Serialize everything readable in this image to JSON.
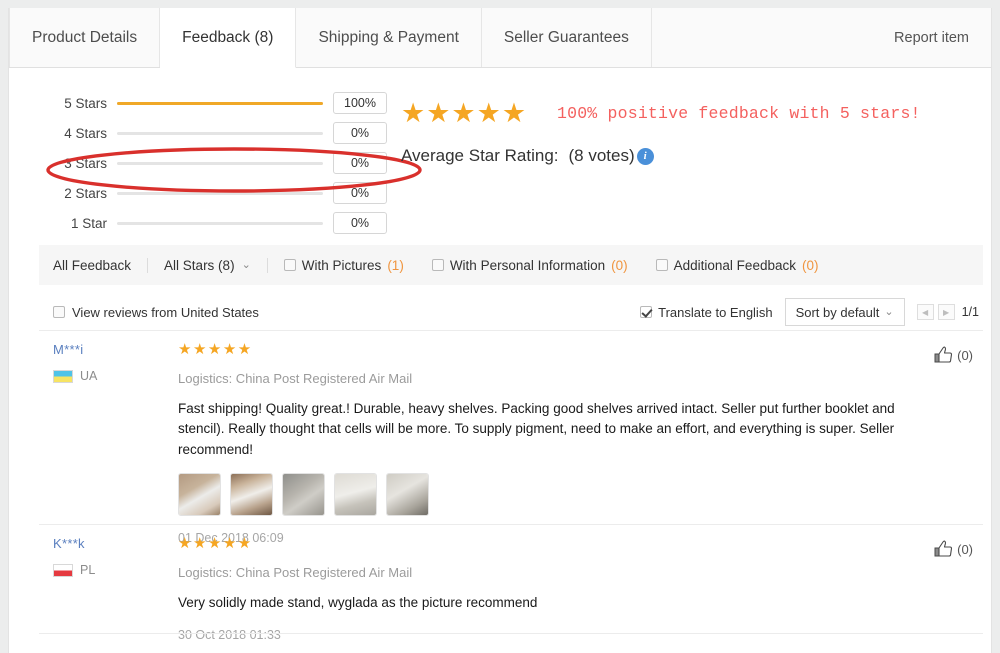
{
  "tabs": [
    {
      "label": "Product Details",
      "active": false
    },
    {
      "label": "Feedback (8)",
      "active": true
    },
    {
      "label": "Shipping & Payment",
      "active": false
    },
    {
      "label": "Seller Guarantees",
      "active": false
    }
  ],
  "report_item": "Report item",
  "rating": {
    "bars": [
      {
        "label": "5 Stars",
        "percent_label": "100%",
        "percent": 100
      },
      {
        "label": "4 Stars",
        "percent_label": "0%",
        "percent": 0
      },
      {
        "label": "3 Stars",
        "percent_label": "0%",
        "percent": 0
      },
      {
        "label": "2 Stars",
        "percent_label": "0%",
        "percent": 0
      },
      {
        "label": "1 Star",
        "percent_label": "0%",
        "percent": 0
      }
    ],
    "stars_display": "★★★★★",
    "average_label": "Average Star Rating:",
    "votes": "(8 votes)",
    "info_glyph": "i",
    "annotation_text": "100% positive feedback with 5 stars!",
    "annotation_color": "#f4615f",
    "bar_fill_color": "#f0a828",
    "star_color": "#f5a623"
  },
  "filters": {
    "all_feedback": "All Feedback",
    "all_stars": "All Stars (8)",
    "chevron": "⌄",
    "with_pictures_label": "With Pictures ",
    "with_pictures_count": "(1)",
    "with_personal_label": "With Personal Information",
    "with_personal_count": "(0)",
    "additional_label": "Additional Feedback ",
    "additional_count": "(0)"
  },
  "subfilters": {
    "view_reviews_country": "View reviews from United States",
    "translate_label": "Translate to English",
    "sort_label": "Sort by default",
    "sort_chevron": "⌄",
    "prev_glyph": "◀",
    "next_glyph": "▶",
    "page_count": "1/1"
  },
  "reviews": [
    {
      "user": "M***i",
      "country_code": "UA",
      "flag_class": "flag-ua",
      "stars": "★★★★★",
      "logistics": "Logistics: China Post Registered Air Mail",
      "text": "Fast shipping! Quality great.! Durable, heavy shelves. Packing good shelves arrived intact. Seller put further booklet and stencil). Really thought that cells will be more. To supply pigment, need to make an effort, and everything is super. Seller recommend!",
      "date": "01 Dec 2018 06:09",
      "like_count": "(0)",
      "thumbnails": [
        "t1",
        "t2",
        "t3",
        "t4",
        "t5"
      ]
    },
    {
      "user": "K***k",
      "country_code": "PL",
      "flag_class": "flag-pl",
      "stars": "★★★★★",
      "logistics": "Logistics: China Post Registered Air Mail",
      "text": "Very solidly made stand, wyglada as the picture recommend",
      "date": "30 Oct 2018 01:33",
      "like_count": "(0)",
      "thumbnails": []
    }
  ]
}
